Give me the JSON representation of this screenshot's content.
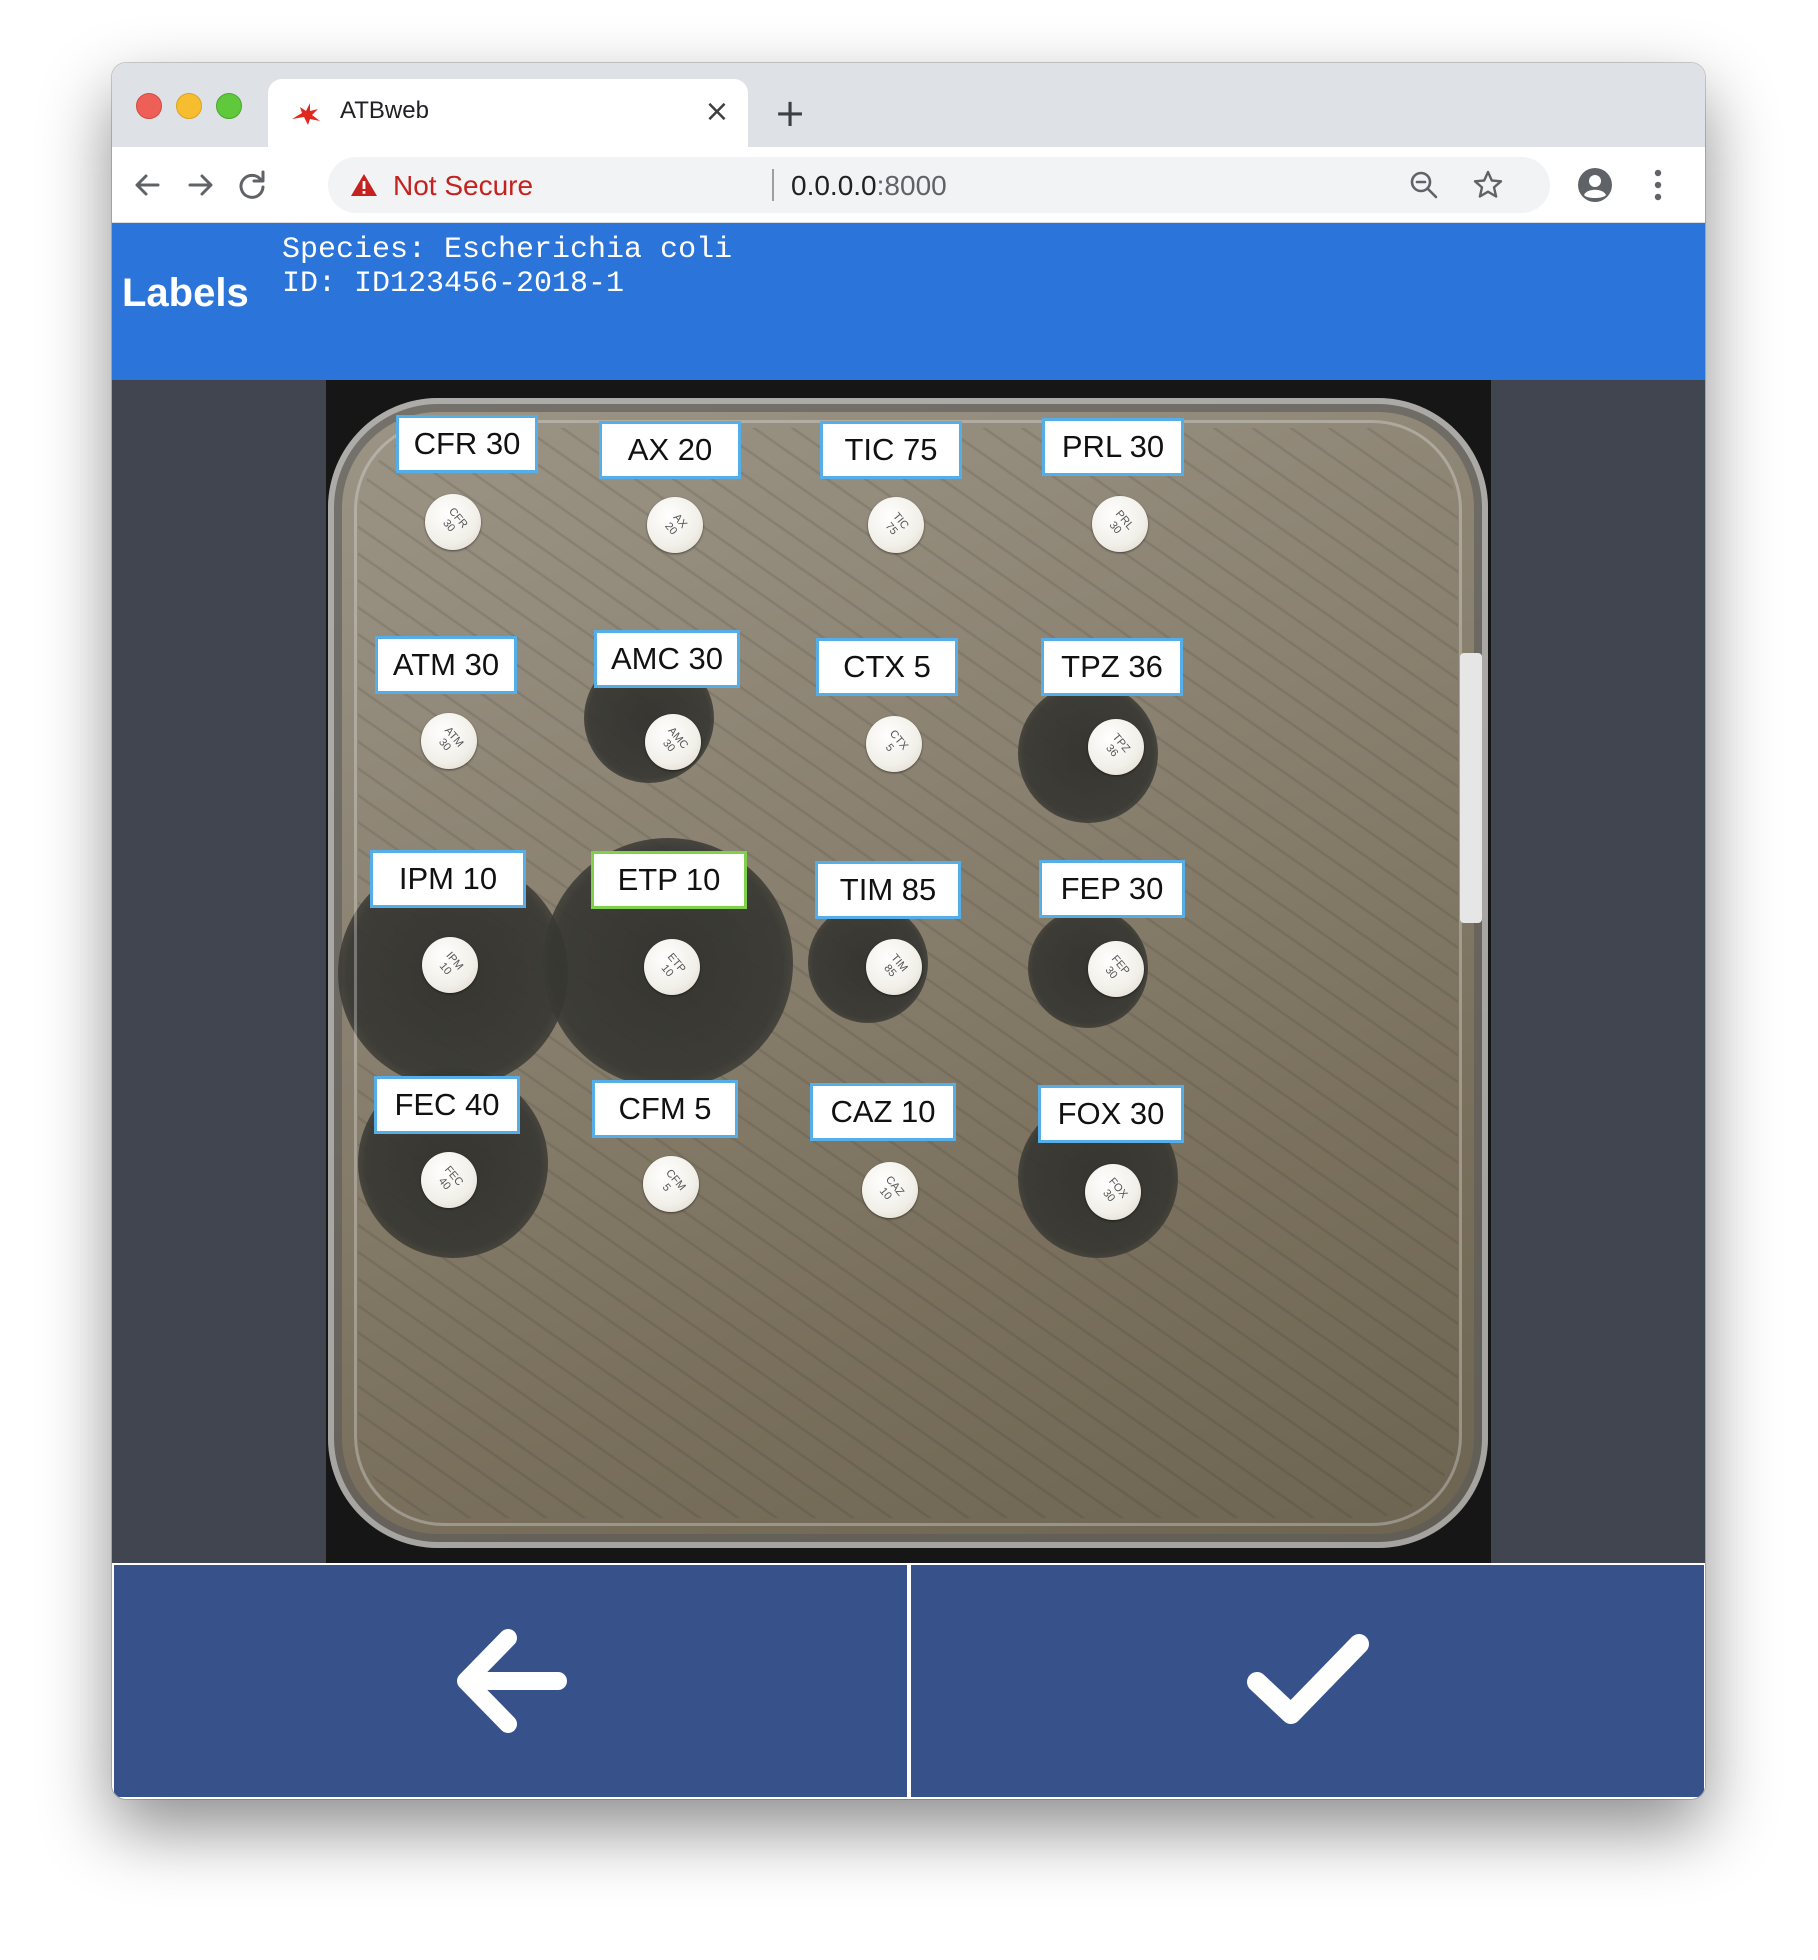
{
  "browser": {
    "tab_title": "ATBweb",
    "tab_close_glyph": "×",
    "new_tab_glyph": "+",
    "security_label": "Not Secure",
    "url_host": "0.0.0.0",
    "url_port": ":8000",
    "icons": [
      "back-arrow-icon",
      "forward-arrow-icon",
      "reload-icon",
      "warning-icon",
      "zoom-icon",
      "star-icon",
      "account-icon",
      "menu-icon"
    ]
  },
  "header": {
    "title": "Labels",
    "species_line": "Species: Escherichia coli",
    "id_line": "ID: ID123456-2018-1",
    "background_color": "#2b74d9"
  },
  "plate": {
    "labels": [
      {
        "text": "CFR 30",
        "disc_text": "CFR\n30",
        "selected": false
      },
      {
        "text": "AX 20",
        "disc_text": "AX\n20",
        "selected": false
      },
      {
        "text": "TIC 75",
        "disc_text": "TIC\n75",
        "selected": false
      },
      {
        "text": "PRL 30",
        "disc_text": "PRL\n30",
        "selected": false
      },
      {
        "text": "ATM 30",
        "disc_text": "ATM\n30",
        "selected": false
      },
      {
        "text": "AMC 30",
        "disc_text": "AMC\n30",
        "selected": false
      },
      {
        "text": "CTX 5",
        "disc_text": "CTX\n5",
        "selected": false
      },
      {
        "text": "TPZ 36",
        "disc_text": "TPZ\n36",
        "selected": false
      },
      {
        "text": "IPM 10",
        "disc_text": "IPM\n10",
        "selected": false
      },
      {
        "text": "ETP 10",
        "disc_text": "ETP\n10",
        "selected": true
      },
      {
        "text": "TIM 85",
        "disc_text": "TIM\n85",
        "selected": false
      },
      {
        "text": "FEP 30",
        "disc_text": "FEP\n30",
        "selected": false
      },
      {
        "text": "FEC 40",
        "disc_text": "FEC\n40",
        "selected": false
      },
      {
        "text": "CFM 5",
        "disc_text": "CFM\n5",
        "selected": false
      },
      {
        "text": "CAZ 10",
        "disc_text": "CAZ\n10",
        "selected": false
      },
      {
        "text": "FOX 30",
        "disc_text": "FOX\n30",
        "selected": false
      }
    ],
    "label_border_color": "#55aee8",
    "selected_border_color": "#7fd14b"
  },
  "actions": {
    "back_icon": "left-arrow-icon",
    "confirm_icon": "checkmark-icon",
    "button_color": "#37518b"
  }
}
